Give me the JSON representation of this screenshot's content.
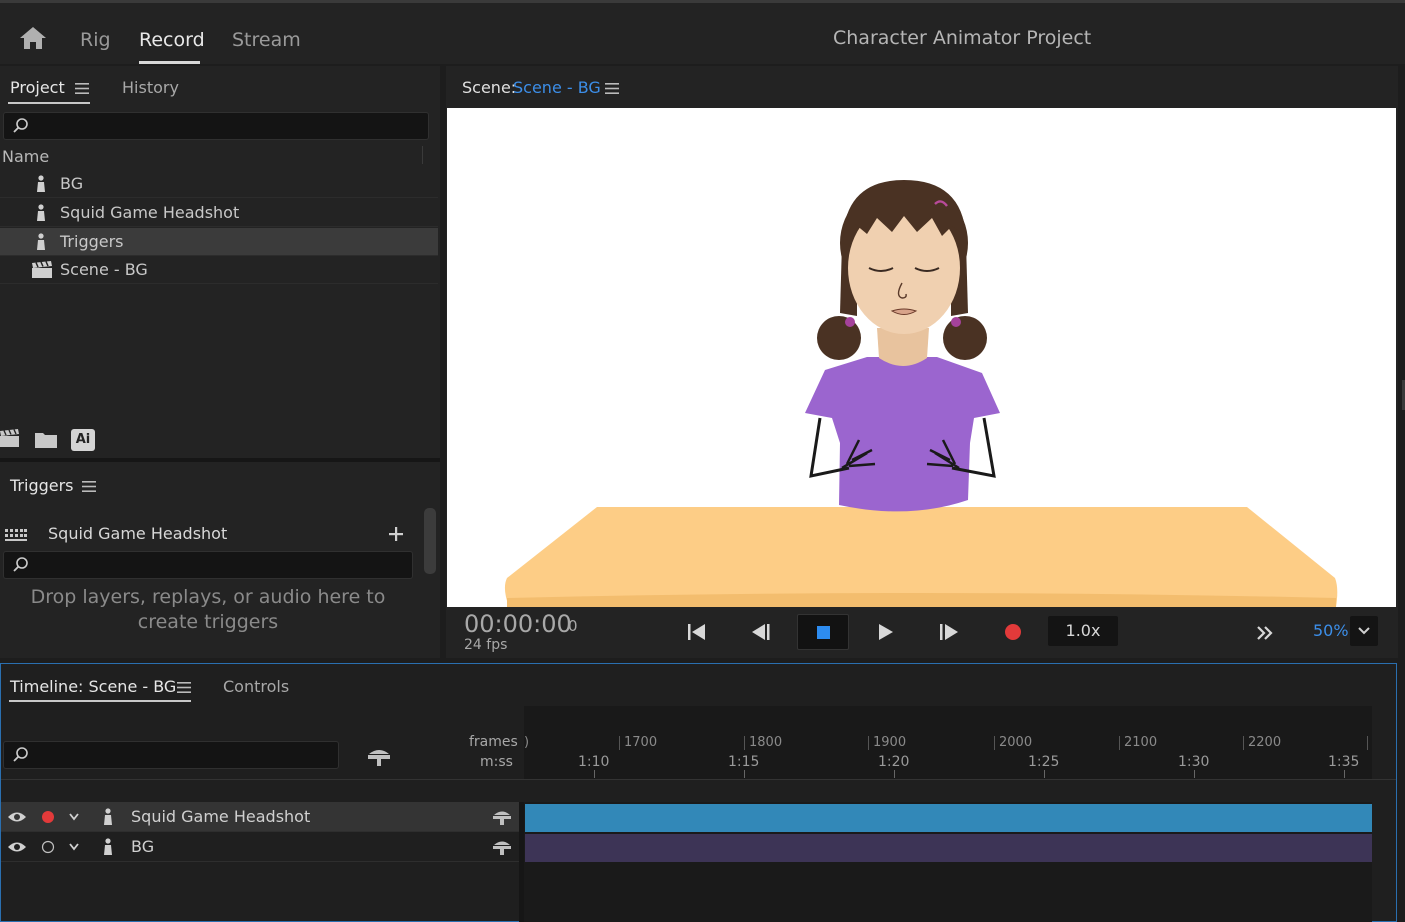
{
  "topbar": {
    "workspaces": [
      "Rig",
      "Record",
      "Stream"
    ],
    "active_workspace": "Record",
    "title": "Character Animator Project"
  },
  "project": {
    "tabs": {
      "project": "Project",
      "history": "History"
    },
    "search_placeholder": "",
    "column_name": "Name",
    "items": [
      {
        "label": "BG",
        "icon": "puppet-icon"
      },
      {
        "label": "Squid Game Headshot",
        "icon": "puppet-icon"
      },
      {
        "label": "Triggers",
        "icon": "puppet-icon",
        "selected": true
      },
      {
        "label": "Scene - BG",
        "icon": "scene-icon"
      }
    ],
    "footer_ai_label": "Ai"
  },
  "triggers": {
    "title": "Triggers",
    "puppet": "Squid Game Headshot",
    "hint": "Drop layers, replays, or audio here to create triggers"
  },
  "scene": {
    "label": "Scene:",
    "name": "Scene - BG",
    "timecode": "00:00:00",
    "frame": "0",
    "fps": "24 fps",
    "speed": "1.0x",
    "zoom": "50%",
    "colors": {
      "accent": "#3c8ee8",
      "record": "#e23a3a",
      "stop": "#2d8cf0"
    }
  },
  "timeline": {
    "tabs": {
      "timeline": "Timeline: Scene - BG",
      "controls": "Controls"
    },
    "ruler_labels": {
      "frames": "frames",
      "mss": "m:ss"
    },
    "frame_ticks": [
      "1700",
      "1800",
      "1900",
      "2000",
      "2100",
      "2200"
    ],
    "time_ticks": [
      "1:10",
      "1:15",
      "1:20",
      "1:25",
      "1:30",
      "1:35"
    ],
    "layers": [
      {
        "name": "Squid Game Headshot",
        "armed": true,
        "bar_color": "#3288b8"
      },
      {
        "name": "BG",
        "armed": false,
        "bar_color": "#3d3456"
      }
    ]
  }
}
